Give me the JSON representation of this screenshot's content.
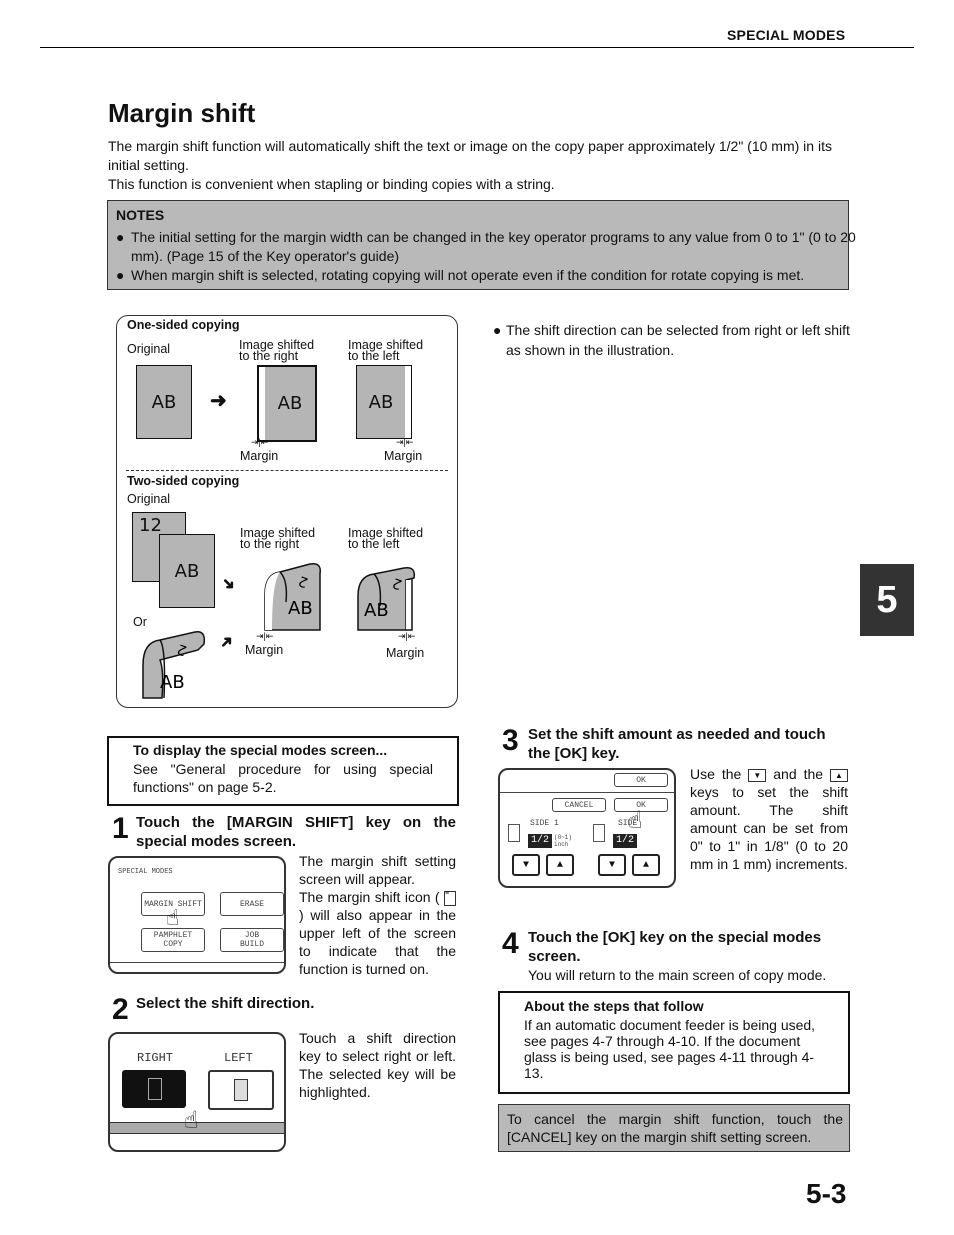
{
  "header": {
    "section": "SPECIAL MODES"
  },
  "title": "Margin shift",
  "intro": [
    "The margin shift function will automatically shift the text or image on the copy paper approximately 1/2\" (10 mm) in its initial setting.",
    "This function is convenient when stapling or binding copies with a string."
  ],
  "notes": {
    "title": "NOTES",
    "items": [
      "The initial setting for the margin width can be changed in the key operator programs to any value from 0 to 1\" (0 to 20 mm). (Page 15 of the Key operator's guide)",
      "When margin shift is selected, rotating copying will not operate even if the condition for rotate copying is met."
    ]
  },
  "diagram": {
    "one_sided": {
      "title": "One-sided copying",
      "original": "Original",
      "shift_right": [
        "Image shifted",
        "to the right"
      ],
      "shift_left": [
        "Image shifted",
        "to the left"
      ],
      "page_text": "AB",
      "margin": "Margin"
    },
    "two_sided": {
      "title": "Two-sided copying",
      "original": "Original",
      "or": "Or",
      "shift_right": [
        "Image shifted",
        "to the right"
      ],
      "shift_left": [
        "Image shifted",
        "to the left"
      ],
      "back_text": "12",
      "page_text": "AB",
      "curl_text": "2",
      "margin": "Margin"
    }
  },
  "side_note": "The shift direction can be selected from right or left shift as shown in the illustration.",
  "display_box": {
    "title": "To display the special modes screen...",
    "text": "See \"General procedure for using special functions\" on page 5-2."
  },
  "steps": [
    {
      "number": "1",
      "heading": "Touch the [MARGIN SHIFT] key on the special modes screen.",
      "text": [
        "The margin shift setting screen will appear.",
        "The margin shift icon ( ",
        ") will also appear in the upper left of the screen to indicate that the function is turned on."
      ],
      "screen": {
        "title": "SPECIAL MODES",
        "keys": [
          "MARGIN SHIFT",
          "ERASE",
          "PAMPHLET COPY",
          "JOB\nBUILD"
        ]
      }
    },
    {
      "number": "2",
      "heading": "Select the shift direction.",
      "text": "Touch a shift direction key to select right or left. The selected key will be highlighted.",
      "screen": {
        "right": "RIGHT",
        "left": "LEFT",
        "selected": "RIGHT"
      }
    },
    {
      "number": "3",
      "heading": "Set the shift amount as needed and touch the [OK] key.",
      "text": [
        "Use the ",
        " and the ",
        " keys to set the shift amount. The shift amount can be set from 0\" to 1\" in 1/8\" (0 to 20 mm in 1 mm) increments."
      ],
      "screen": {
        "ok_top": "OK",
        "cancel": "CANCEL",
        "ok": "OK",
        "side1": "SIDE 1",
        "side2": "SIDE",
        "value1": "1/2",
        "value2": "1/2",
        "range": "(0~1)",
        "unit": "inch"
      }
    },
    {
      "number": "4",
      "heading": "Touch the [OK] key on the special modes screen.",
      "text": "You will return to the main screen of copy mode."
    }
  ],
  "about_box": {
    "title": "About the steps that follow",
    "text": "If an automatic document feeder is being used, see pages 4-7 through 4-10. If the document glass is being used, see pages 4-11 through 4-13."
  },
  "cancel_note": "To cancel the margin shift function, touch the [CANCEL] key on the margin shift setting screen.",
  "chapter_tab": "5",
  "page_number": "5-3"
}
